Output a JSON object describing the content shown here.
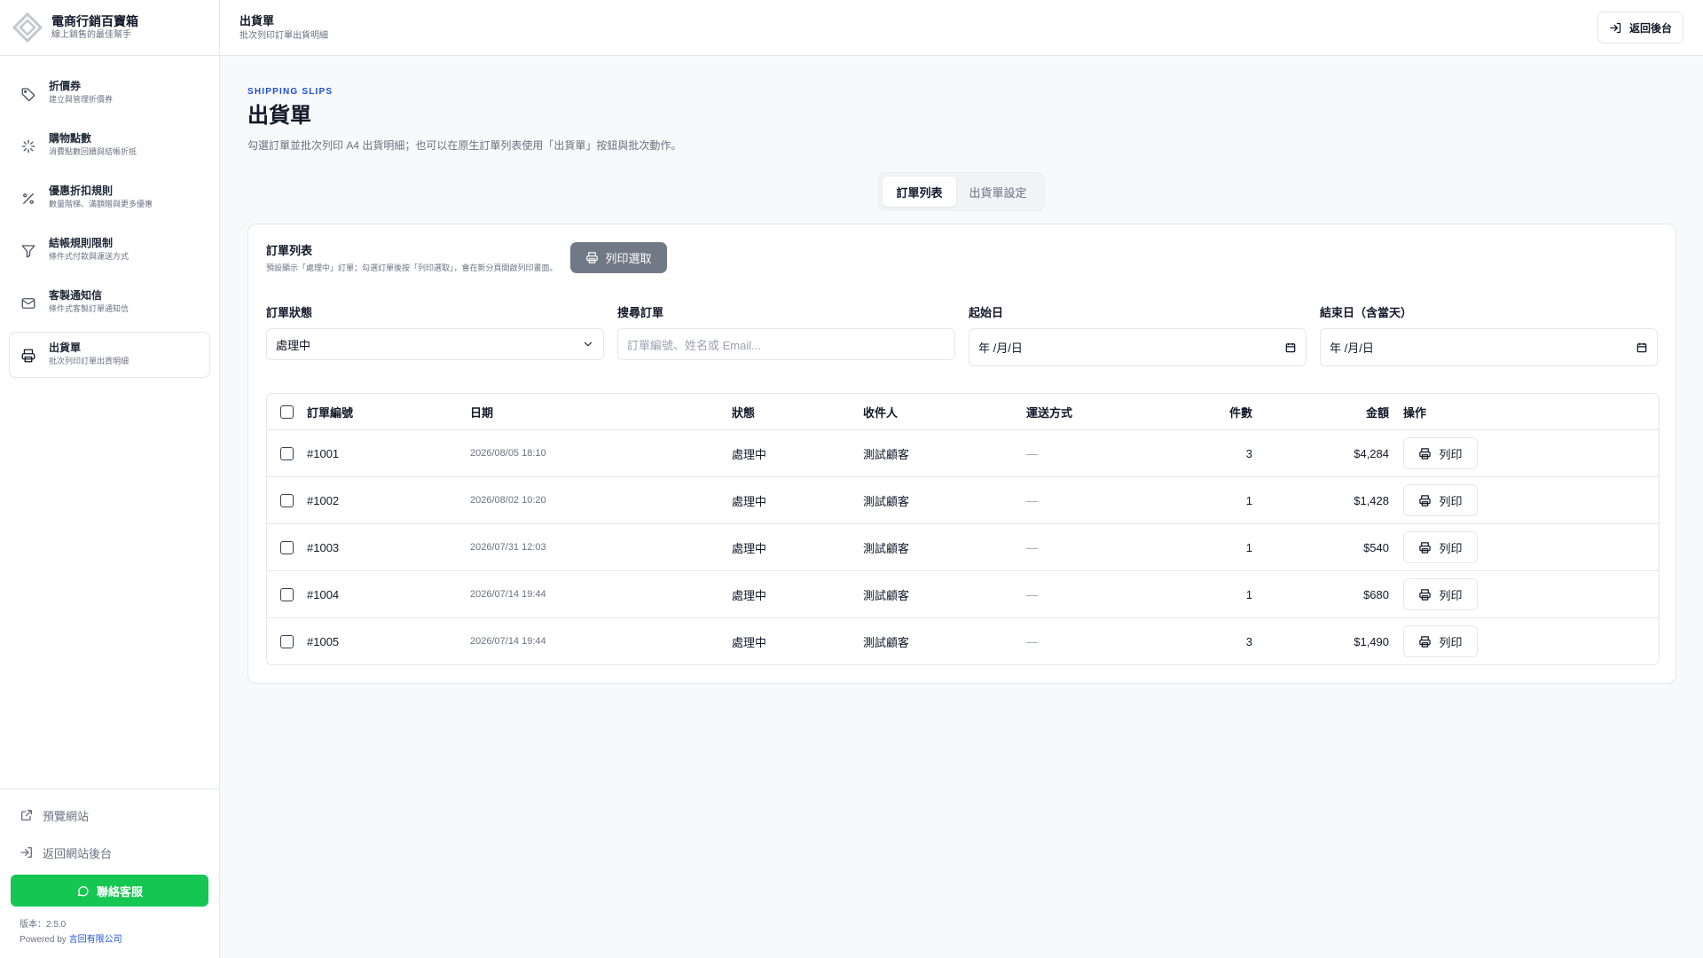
{
  "brand": {
    "title": "電商行銷百寶箱",
    "subtitle": "線上銷售的最佳幫手"
  },
  "sidebar": {
    "items": [
      {
        "label": "折價券",
        "desc": "建立與管理折價券",
        "icon": "tag-icon"
      },
      {
        "label": "購物點數",
        "desc": "消費點數回饋與結帳折抵",
        "icon": "sparkle-icon"
      },
      {
        "label": "優惠折扣規則",
        "desc": "數量階梯、滿額贈與更多優惠",
        "icon": "percent-icon"
      },
      {
        "label": "結帳規則限制",
        "desc": "條件式付款與運送方式",
        "icon": "filter-icon"
      },
      {
        "label": "客製通知信",
        "desc": "條件式客製訂單通知信",
        "icon": "mail-icon"
      },
      {
        "label": "出貨單",
        "desc": "批次列印訂單出貨明細",
        "icon": "printer-icon",
        "active": true
      }
    ],
    "preview_site": "預覽網站",
    "back_to_admin": "返回網站後台",
    "support": "聯絡客服",
    "version": "版本：2.5.0",
    "powered_by": "Powered by",
    "company": "言回有限公司"
  },
  "topbar": {
    "title": "出貨單",
    "subtitle": "批次列印訂單出貨明細",
    "back_label": "返回後台"
  },
  "page": {
    "eyebrow": "SHIPPING SLIPS",
    "title": "出貨單",
    "description": "勾選訂單並批次列印 A4 出貨明細；也可以在原生訂單列表使用「出貨單」按鈕與批次動作。"
  },
  "tabs": [
    {
      "label": "訂單列表",
      "active": true
    },
    {
      "label": "出貨單設定",
      "active": false
    }
  ],
  "card": {
    "title": "訂單列表",
    "note": "預設顯示「處理中」訂單；勾選訂單後按「列印選取」，會在新分頁開啟列印畫面。",
    "print_selected": "列印選取"
  },
  "filters": {
    "status": {
      "label": "訂單狀態",
      "value": "處理中"
    },
    "search": {
      "label": "搜尋訂單",
      "placeholder": "訂單編號、姓名或 Email..."
    },
    "start": {
      "label": "起始日",
      "value": "年 /月/日"
    },
    "end": {
      "label": "結束日（含當天）",
      "value": "年 /月/日"
    }
  },
  "table": {
    "columns": {
      "id": "訂單編號",
      "date": "日期",
      "status": "狀態",
      "name": "收件人",
      "ship": "運送方式",
      "qty": "件數",
      "amount": "金額",
      "op": "操作"
    },
    "print_label": "列印",
    "rows": [
      {
        "id": "#1001",
        "date": "2026/08/05 18:10",
        "status": "處理中",
        "name": "測試顧客",
        "ship": "—",
        "qty": "3",
        "amount": "$4,284"
      },
      {
        "id": "#1002",
        "date": "2026/08/02 10:20",
        "status": "處理中",
        "name": "測試顧客",
        "ship": "—",
        "qty": "1",
        "amount": "$1,428"
      },
      {
        "id": "#1003",
        "date": "2026/07/31 12:03",
        "status": "處理中",
        "name": "測試顧客",
        "ship": "—",
        "qty": "1",
        "amount": "$540"
      },
      {
        "id": "#1004",
        "date": "2026/07/14 19:44",
        "status": "處理中",
        "name": "測試顧客",
        "ship": "—",
        "qty": "1",
        "amount": "$680"
      },
      {
        "id": "#1005",
        "date": "2026/07/14 19:44",
        "status": "處理中",
        "name": "測試顧客",
        "ship": "—",
        "qty": "3",
        "amount": "$1,490"
      }
    ]
  },
  "colors": {
    "accent": "#1d4ed8",
    "support": "#16c653",
    "muted_button": "#6b7280"
  }
}
